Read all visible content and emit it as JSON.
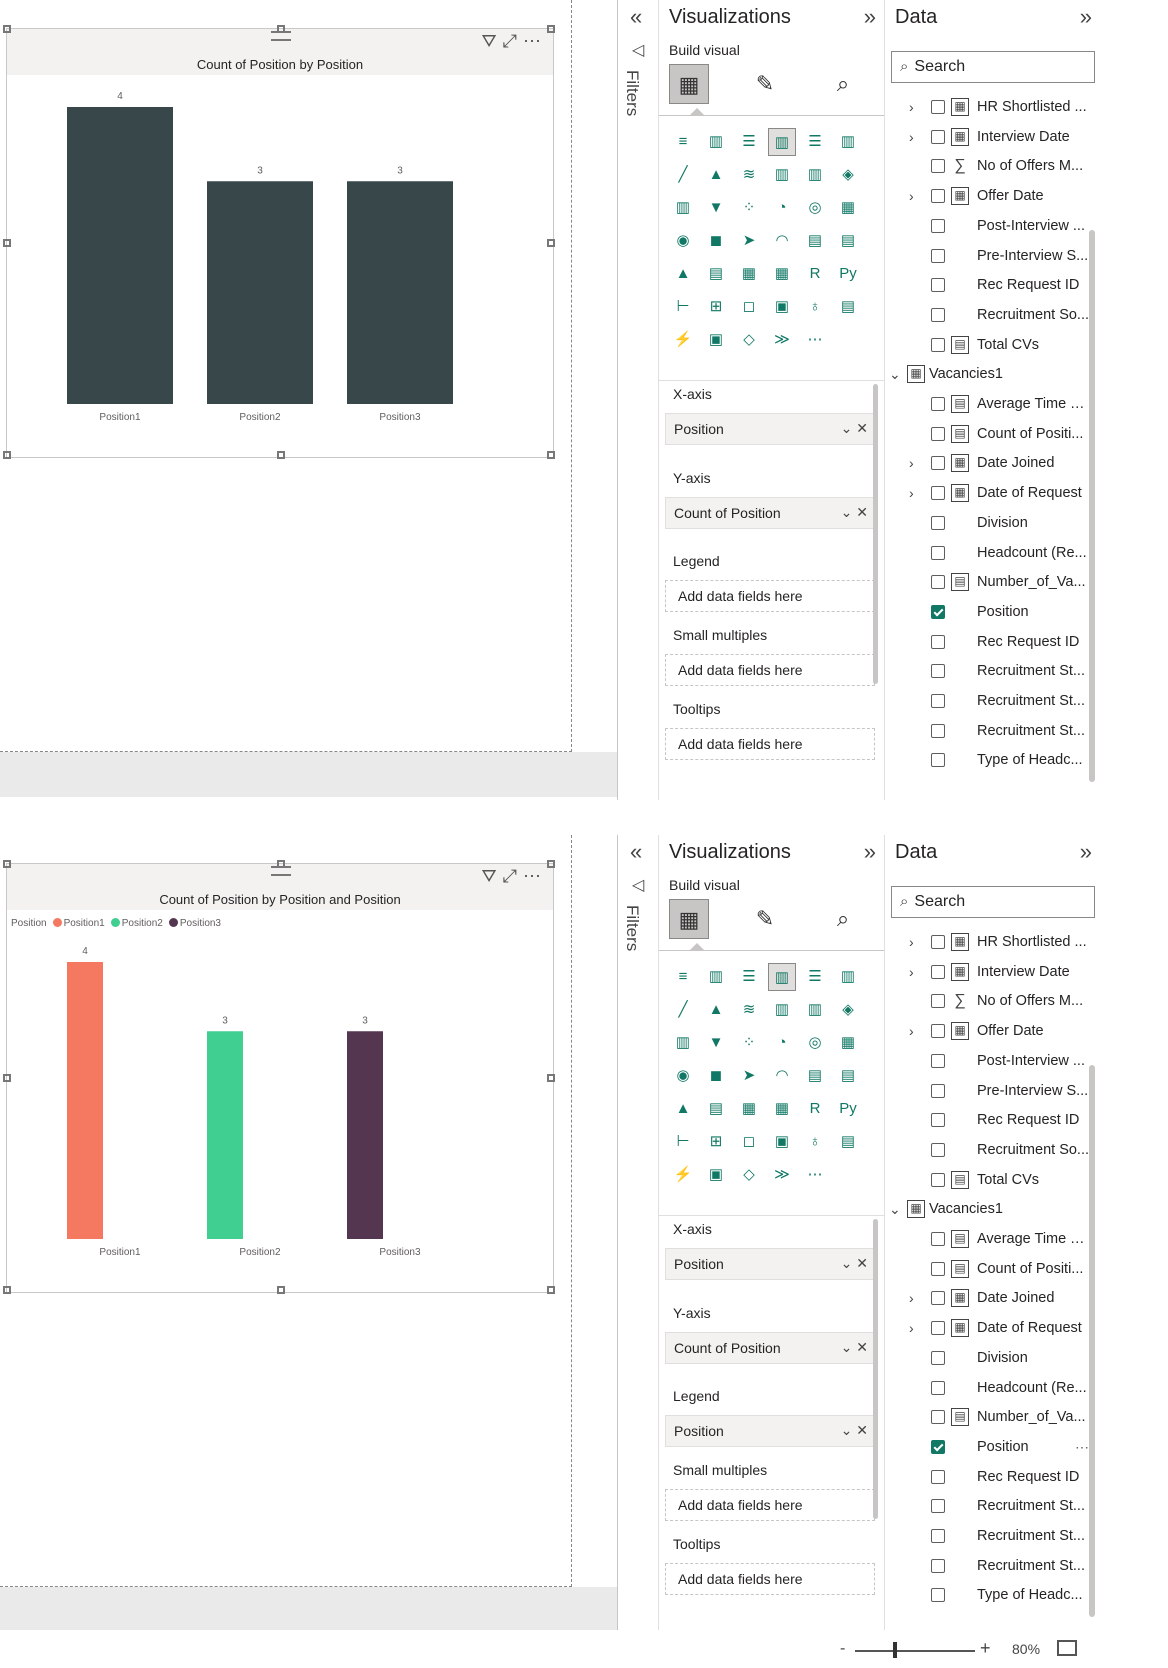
{
  "colors": {
    "bar_default": "#37474a",
    "position1": "#f47960",
    "position2": "#41ce91",
    "position3": "#553650",
    "accent": "#117865"
  },
  "panels": [
    {
      "visual": {
        "title": "Count of Position by Position",
        "legend": null
      },
      "chart_data": {
        "type": "bar",
        "title": "Count of Position by Position",
        "categories": [
          "Position1",
          "Position2",
          "Position3"
        ],
        "values": [
          4,
          3,
          3
        ],
        "data_labels": [
          "4",
          "3",
          "3"
        ],
        "ylim": [
          0,
          4
        ],
        "grid": false,
        "colors": [
          "#37474a",
          "#37474a",
          "#37474a"
        ]
      },
      "viz": {
        "title": "Visualizations",
        "build_label": "Build visual",
        "wells": [
          {
            "label": "X-axis",
            "value": "Position",
            "filled": true
          },
          {
            "label": "Y-axis",
            "value": "Count of Position",
            "filled": true
          },
          {
            "label": "Legend",
            "value": "Add data fields here",
            "filled": false
          },
          {
            "label": "Small multiples",
            "value": "Add data fields here",
            "filled": false
          },
          {
            "label": "Tooltips",
            "value": "Add data fields here",
            "filled": false
          }
        ]
      }
    },
    {
      "visual": {
        "title": "Count of Position by Position and Position",
        "legend": {
          "title": "Position",
          "items": [
            "Position1",
            "Position2",
            "Position3"
          ]
        }
      },
      "chart_data": {
        "type": "bar",
        "title": "Count of Position by Position and Position",
        "categories": [
          "Position1",
          "Position2",
          "Position3"
        ],
        "values": [
          4,
          3,
          3
        ],
        "data_labels": [
          "4",
          "3",
          "3"
        ],
        "ylim": [
          0,
          4
        ],
        "grid": false,
        "legend_position": "top-left",
        "series": [
          {
            "name": "Position1",
            "values": [
              4,
              0,
              0
            ]
          },
          {
            "name": "Position2",
            "values": [
              0,
              3,
              0
            ]
          },
          {
            "name": "Position3",
            "values": [
              0,
              0,
              3
            ]
          }
        ],
        "colors": [
          "#f47960",
          "#41ce91",
          "#553650"
        ]
      },
      "viz": {
        "title": "Visualizations",
        "build_label": "Build visual",
        "wells": [
          {
            "label": "X-axis",
            "value": "Position",
            "filled": true
          },
          {
            "label": "Y-axis",
            "value": "Count of Position",
            "filled": true
          },
          {
            "label": "Legend",
            "value": "Position",
            "filled": true
          },
          {
            "label": "Small multiples",
            "value": "Add data fields here",
            "filled": false
          },
          {
            "label": "Tooltips",
            "value": "Add data fields here",
            "filled": false
          }
        ]
      }
    }
  ],
  "filters_label": "Filters",
  "data_pane": {
    "title": "Data",
    "search_placeholder": "Search",
    "fields": [
      {
        "name": "HR Shortlisted ...",
        "icon": "calendar-icon",
        "expandable": true,
        "checked": false
      },
      {
        "name": "Interview Date",
        "icon": "calendar-icon",
        "expandable": true,
        "checked": false
      },
      {
        "name": "No of Offers M...",
        "icon": "sigma-icon",
        "expandable": false,
        "checked": false
      },
      {
        "name": "Offer Date",
        "icon": "calendar-icon",
        "expandable": true,
        "checked": false
      },
      {
        "name": "Post-Interview ...",
        "icon": "",
        "expandable": false,
        "checked": false
      },
      {
        "name": "Pre-Interview S...",
        "icon": "",
        "expandable": false,
        "checked": false
      },
      {
        "name": "Rec Request ID",
        "icon": "",
        "expandable": false,
        "checked": false
      },
      {
        "name": "Recruitment So...",
        "icon": "",
        "expandable": false,
        "checked": false
      },
      {
        "name": "Total CVs",
        "icon": "calculator-icon",
        "expandable": false,
        "checked": false
      },
      {
        "name": "Vacancies1",
        "icon": "table-icon",
        "expandable": true,
        "checked": false,
        "is_table": true
      },
      {
        "name": "Average Time T...",
        "icon": "calculator-icon",
        "expandable": false,
        "checked": false
      },
      {
        "name": "Count of Positi...",
        "icon": "calculator-icon",
        "expandable": false,
        "checked": false
      },
      {
        "name": "Date Joined",
        "icon": "calendar-icon",
        "expandable": true,
        "checked": false
      },
      {
        "name": "Date of Request",
        "icon": "calendar-icon",
        "expandable": true,
        "checked": false
      },
      {
        "name": "Division",
        "icon": "",
        "expandable": false,
        "checked": false
      },
      {
        "name": "Headcount (Re...",
        "icon": "",
        "expandable": false,
        "checked": false
      },
      {
        "name": "Number_of_Va...",
        "icon": "calculator-icon",
        "expandable": false,
        "checked": false
      },
      {
        "name": "Position",
        "icon": "",
        "expandable": false,
        "checked": true
      },
      {
        "name": "Rec Request ID",
        "icon": "",
        "expandable": false,
        "checked": false
      },
      {
        "name": "Recruitment St...",
        "icon": "",
        "expandable": false,
        "checked": false
      },
      {
        "name": "Recruitment St...",
        "icon": "",
        "expandable": false,
        "checked": false
      },
      {
        "name": "Recruitment St...",
        "icon": "",
        "expandable": false,
        "checked": false
      },
      {
        "name": "Type of Headc...",
        "icon": "",
        "expandable": false,
        "checked": false
      }
    ]
  },
  "status": {
    "zoom_minus": "-",
    "zoom_plus": "+",
    "zoom_level": "80%",
    "zoom_value": 80
  }
}
